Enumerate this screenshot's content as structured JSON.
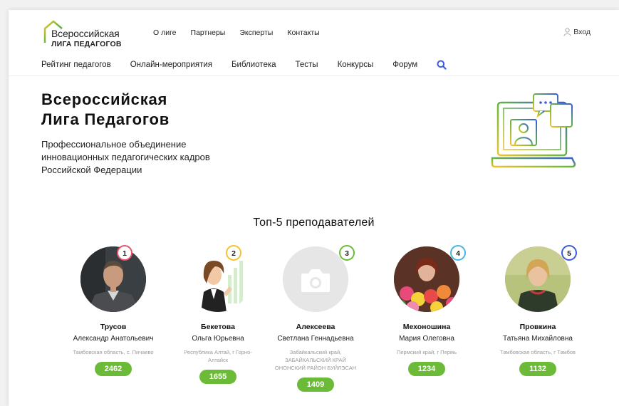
{
  "logo": {
    "line1": "Всероссийская",
    "line2": "ЛИГА ПЕДАГОГОВ"
  },
  "topnav": [
    "О лиге",
    "Партнеры",
    "Эксперты",
    "Контакты"
  ],
  "login": {
    "label": "Вход",
    "icon": "user-icon"
  },
  "mainnav": [
    "Рейтинг педагогов",
    "Онлайн-мероприятия",
    "Библиотека",
    "Тесты",
    "Конкурсы",
    "Форум"
  ],
  "search": {
    "icon": "search-icon",
    "color": "#3b5bdb"
  },
  "hero": {
    "title_line1": "Всероссийская",
    "title_line2": "Лига Педагогов",
    "subtitle_line1": "Профессиональное объединение",
    "subtitle_line2": "инновационных педагогических кадров",
    "subtitle_line3": "Российской Федерации"
  },
  "top5": {
    "heading": "Топ-5 преподавателей",
    "teachers": [
      {
        "rank": "1",
        "rank_color": "#e8536a",
        "last_name": "Трусов",
        "first_name": "Александр Анатольевич",
        "region": "Тамбовская область, с. Пичаево",
        "score": "2462"
      },
      {
        "rank": "2",
        "rank_color": "#f2c230",
        "last_name": "Бекетова",
        "first_name": "Ольга Юрьевна",
        "region": "Республика Алтай, г Горно-Алтайск",
        "score": "1655"
      },
      {
        "rank": "3",
        "rank_color": "#6cbb38",
        "last_name": "Алексеева",
        "first_name": "Светлана Геннадьевна",
        "region": "Забайкальский край, ЗАБАЙКАЛЬСКИЙ КРАЙ ОНОНСКИЙ РАЙОН БУЙЛЭСАН",
        "score": "1409"
      },
      {
        "rank": "4",
        "rank_color": "#4ab3e8",
        "last_name": "Мехоношина",
        "first_name": "Мария Олеговна",
        "region": "Пермский край, г Пермь",
        "score": "1234"
      },
      {
        "rank": "5",
        "rank_color": "#3b5bdb",
        "last_name": "Провкина",
        "first_name": "Татьяна Михайловна",
        "region": "Тамбовская область, г Тамбов",
        "score": "1132"
      }
    ]
  },
  "colors": {
    "accent_green": "#6cbb38",
    "accent_blue": "#3b5bdb"
  }
}
